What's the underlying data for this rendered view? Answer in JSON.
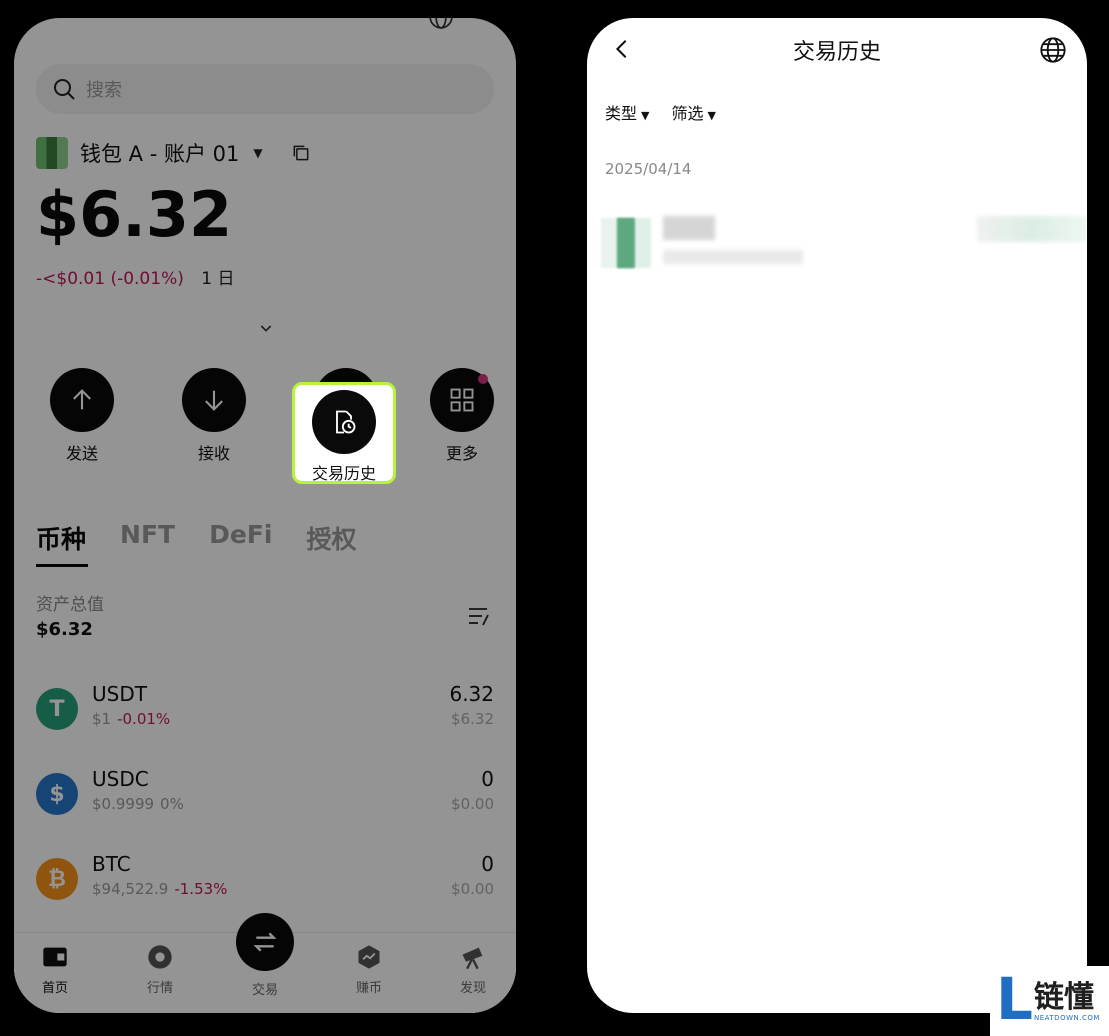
{
  "left_screen": {
    "search_placeholder": "搜索",
    "wallet_name": "钱包 A - 账户 01",
    "balance": "$6.32",
    "change": "-<$0.01 (-0.01%)",
    "change_period": "1 日",
    "actions": [
      {
        "label": "发送",
        "icon": "arrow-up-icon"
      },
      {
        "label": "接收",
        "icon": "arrow-down-icon"
      },
      {
        "label": "交易历史",
        "icon": "history-doc-icon",
        "highlighted": true
      },
      {
        "label": "更多",
        "icon": "grid-icon",
        "badge": true
      }
    ],
    "tabs": [
      "币种",
      "NFT",
      "DeFi",
      "授权"
    ],
    "active_tab": "币种",
    "total_assets_label": "资产总值",
    "total_assets_value": "$6.32",
    "tokens": [
      {
        "symbol": "USDT",
        "price": "$1",
        "change": "-0.01%",
        "change_color": "#c2185b",
        "qty": "6.32",
        "usd": "$6.32",
        "logo_color": "#26a17b",
        "logo_text": "T"
      },
      {
        "symbol": "USDC",
        "price": "$0.9999",
        "change": "0%",
        "change_color": "#999999",
        "qty": "0",
        "usd": "$0.00",
        "logo_color": "#2775ca",
        "logo_text": "$"
      },
      {
        "symbol": "BTC",
        "price": "$94,522.9",
        "change": "-1.53%",
        "change_color": "#c2185b",
        "qty": "0",
        "usd": "$0.00",
        "logo_color": "#f7931a",
        "logo_text": "₿"
      }
    ],
    "nav": [
      {
        "label": "首页",
        "icon": "wallet-icon"
      },
      {
        "label": "行情",
        "icon": "market-icon"
      },
      {
        "label": "交易",
        "icon": "swap-icon"
      },
      {
        "label": "赚币",
        "icon": "earn-icon"
      },
      {
        "label": "发现",
        "icon": "telescope-icon"
      }
    ],
    "highlight_color": "#b8f23a"
  },
  "right_screen": {
    "title": "交易历史",
    "filters": [
      "类型",
      "筛选"
    ],
    "date_header": "2025/04/14"
  },
  "brand": {
    "cn": "链懂",
    "en": "NEATDOWN.COM",
    "color": "#1e6fc2"
  }
}
